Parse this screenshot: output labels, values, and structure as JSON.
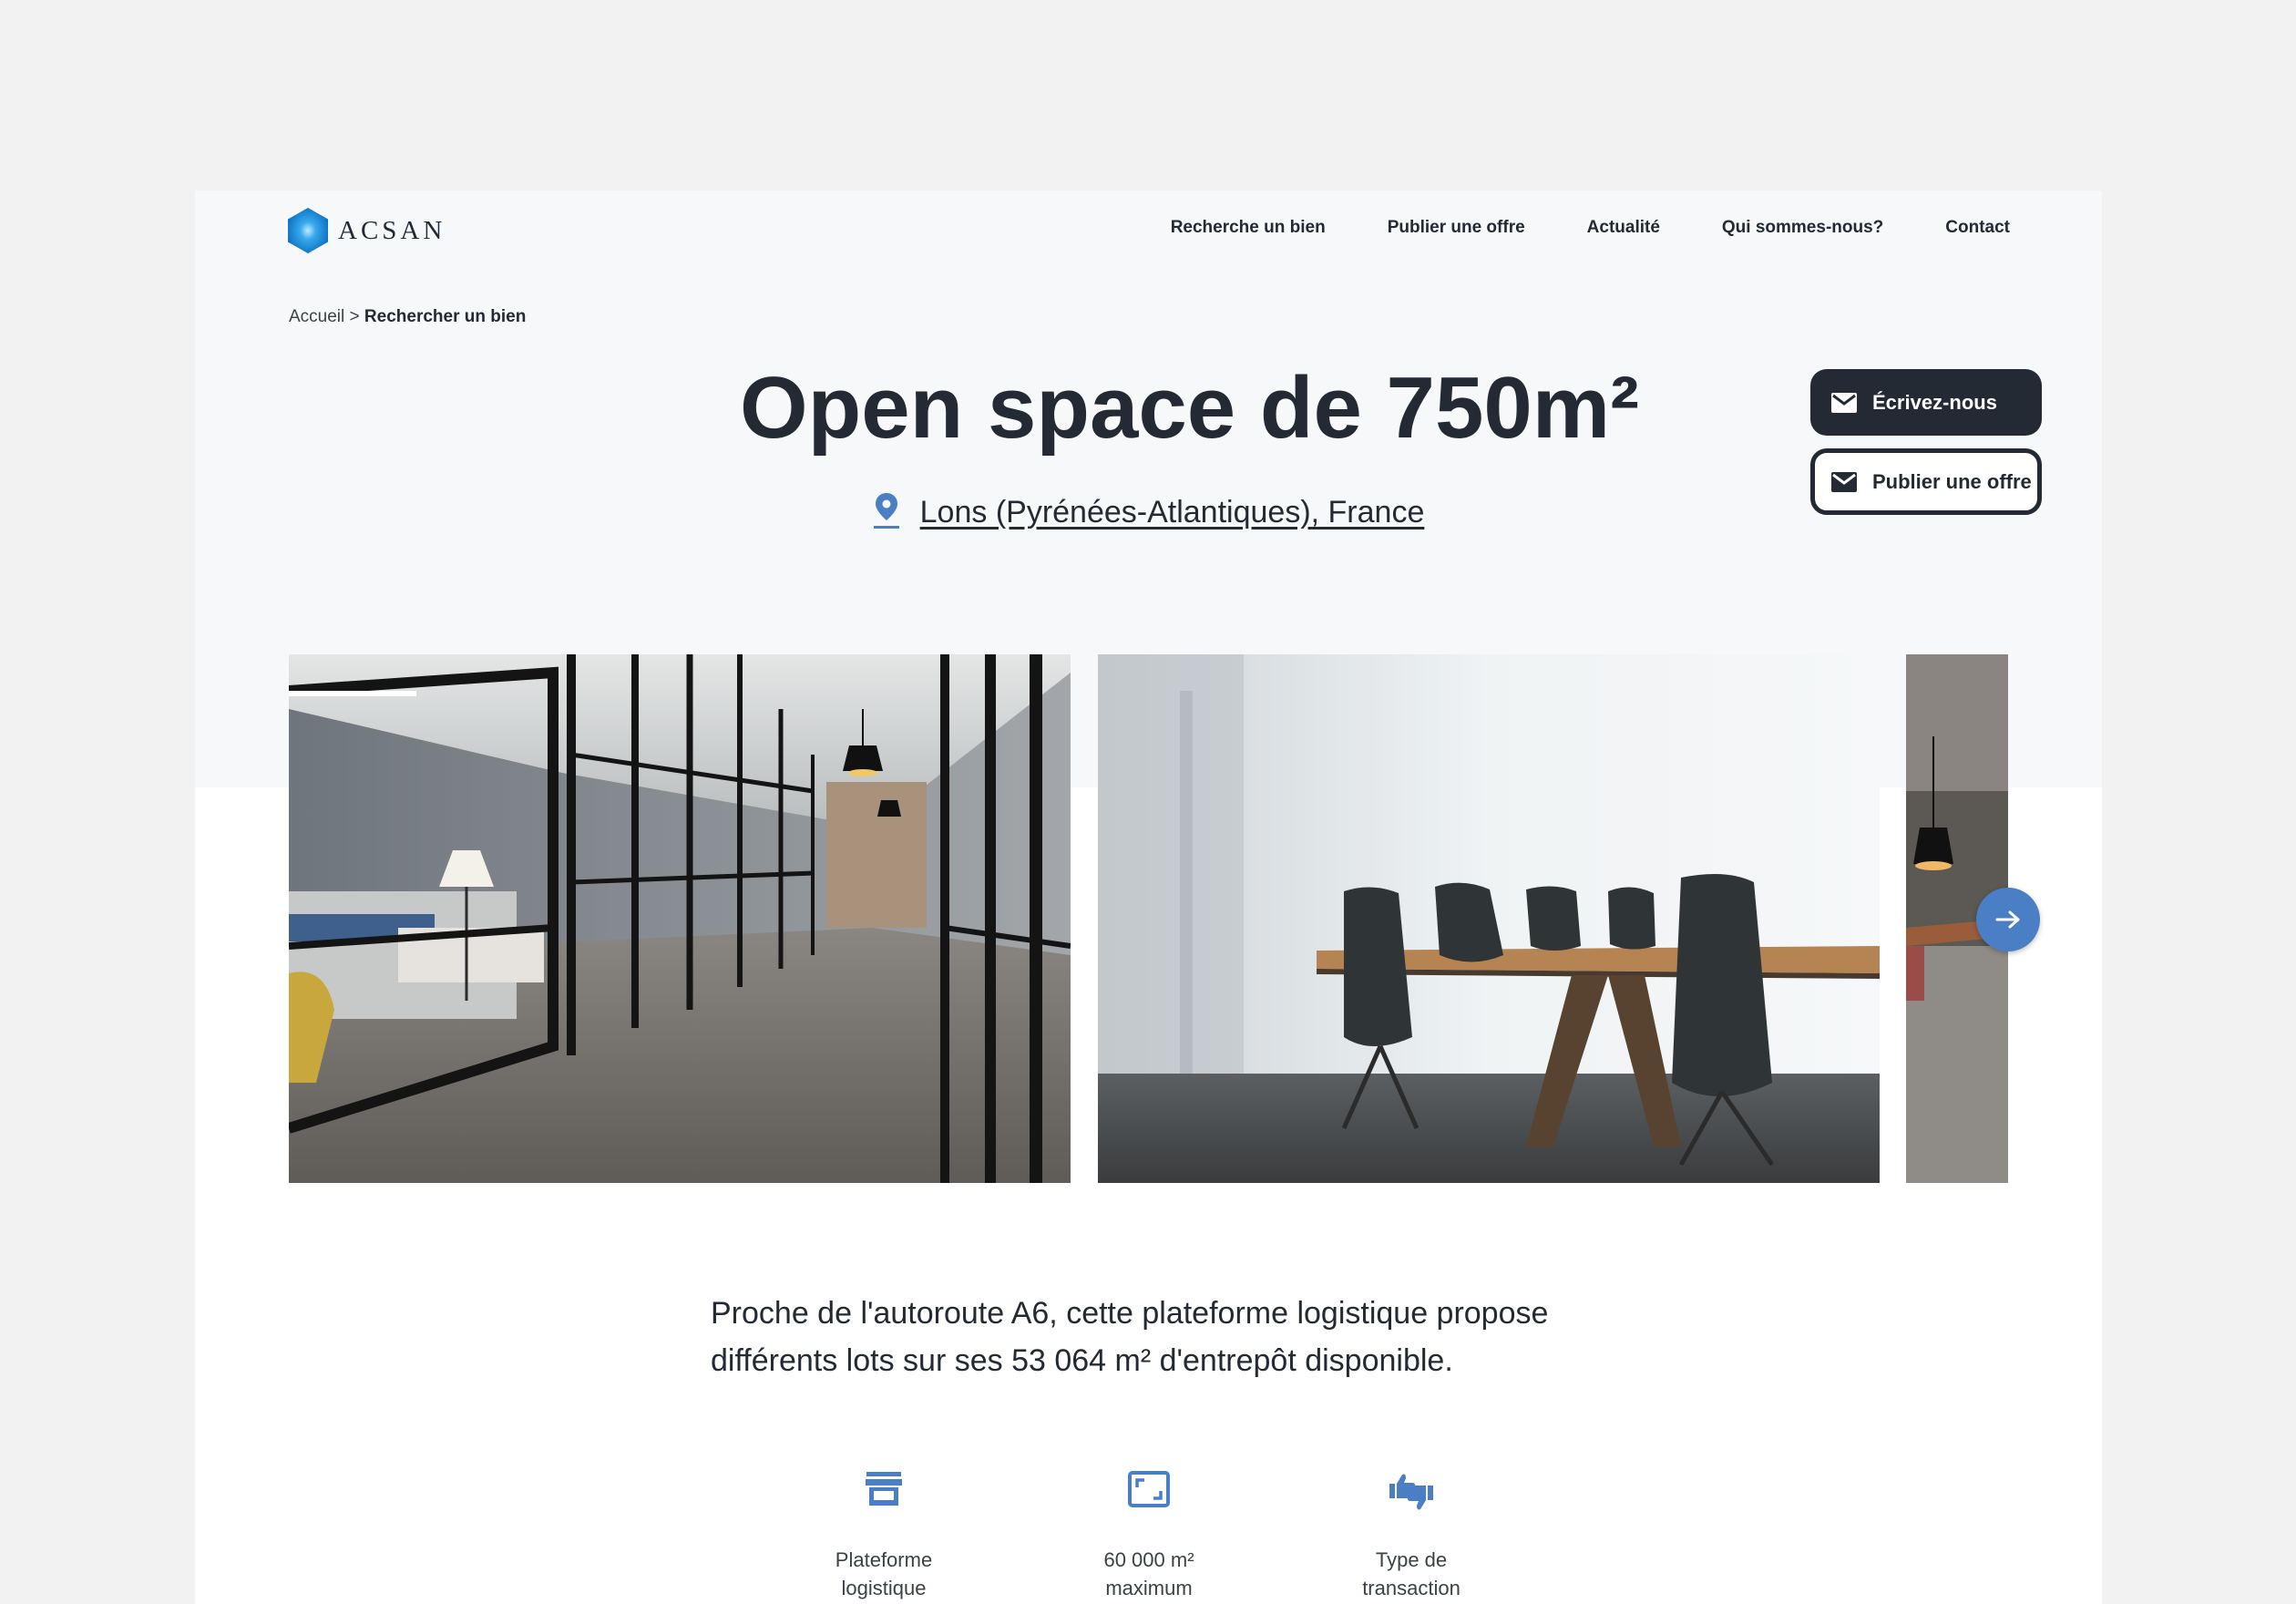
{
  "brand": {
    "name": "ACSAN",
    "colors": {
      "logo": "#1a8fd9",
      "accent": "#4a7fc6",
      "dark": "#232a33"
    }
  },
  "nav": {
    "items": [
      {
        "label": "Recherche un bien"
      },
      {
        "label": "Publier une offre"
      },
      {
        "label": "Actualité"
      },
      {
        "label": "Qui sommes-nous?"
      },
      {
        "label": "Contact"
      }
    ]
  },
  "breadcrumb": {
    "home": "Accueil",
    "separator": ">",
    "current": "Rechercher un bien"
  },
  "listing": {
    "title": "Open space de 750m²",
    "location": "Lons (Pyrénées-Atlantiques), France",
    "description": "Proche de l'autoroute A6, cette plateforme logistique propose différents lots sur ses 53 064 m² d'entrepôt disponible."
  },
  "actions": {
    "contact_label": "Écrivez-nous",
    "publish_label": "Publier une offre",
    "icon": "mail-icon"
  },
  "gallery": {
    "photos": [
      "office-corridor-photo",
      "meeting-room-photo",
      "open-office-photo"
    ],
    "next_icon": "arrow-right-icon"
  },
  "features": [
    {
      "icon": "store-icon",
      "label": "Plateforme\nlogistique"
    },
    {
      "icon": "area-icon",
      "label": "60 000 m²\nmaximum"
    },
    {
      "icon": "thumbs-icon",
      "label": "Type de\ntransaction"
    }
  ]
}
